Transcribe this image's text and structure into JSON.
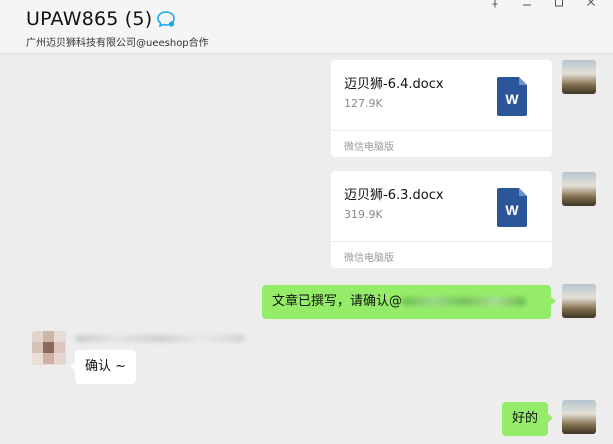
{
  "window": {
    "title": "UPAW865 (5)",
    "subtitle": "广州迈贝狮科技有限公司@ueeshop合作"
  },
  "messages": [
    {
      "type": "file",
      "sender": "self",
      "file_name": "迈贝狮-6.4.docx",
      "file_size": "127.9K",
      "file_type": "W",
      "source": "微信电脑版"
    },
    {
      "type": "file",
      "sender": "self",
      "file_name": "迈贝狮-6.3.docx",
      "file_size": "319.9K",
      "file_type": "W",
      "source": "微信电脑版"
    },
    {
      "type": "text",
      "sender": "self",
      "text": "文章已撰写，请确认@"
    },
    {
      "type": "text",
      "sender": "other",
      "text": "确认 ~"
    },
    {
      "type": "text",
      "sender": "self",
      "text": "好的"
    }
  ],
  "colors": {
    "self_bubble": "#95ec69",
    "other_bubble": "#ffffff",
    "chat_background": "#ededed",
    "word_icon": "#2b579a"
  },
  "icons": [
    "chat-bubble-icon",
    "pin-icon",
    "minimize-icon",
    "maximize-icon",
    "close-icon",
    "word-file-icon"
  ]
}
